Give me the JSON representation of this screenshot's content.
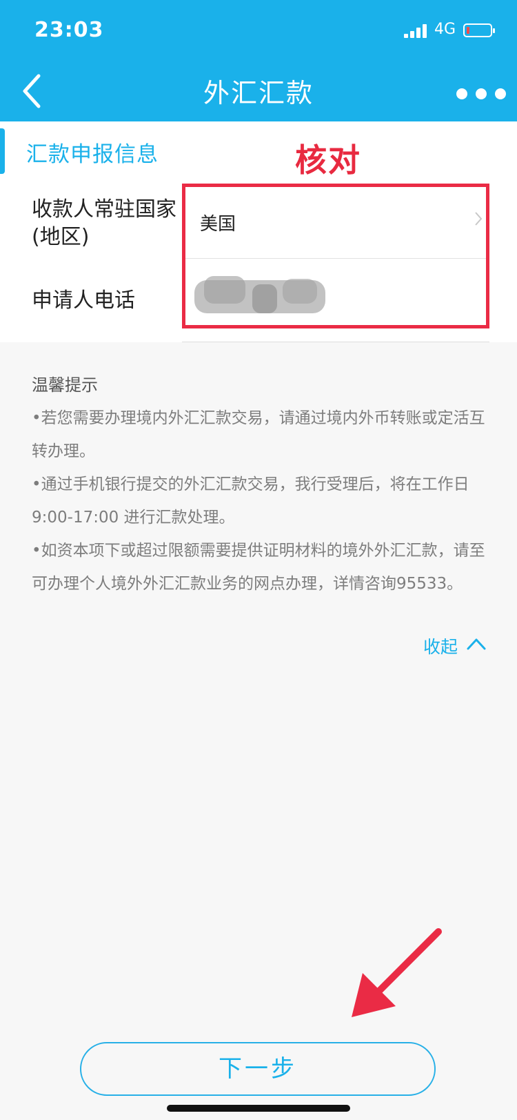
{
  "status_bar": {
    "time": "23:03",
    "network": "4G"
  },
  "nav": {
    "title": "外汇汇款",
    "back_icon": "chevron-left-icon",
    "more_icon": "more-dots-icon"
  },
  "section": {
    "title": "汇款申报信息"
  },
  "annotation": {
    "text": "核对",
    "color": "#e82a40"
  },
  "form": {
    "rows": [
      {
        "label": "收款人常驻国家(地区)",
        "value": "美国"
      },
      {
        "label": "申请人电话",
        "value": ""
      }
    ]
  },
  "tips": {
    "title": "温馨提示",
    "items": [
      "•若您需要办理境内外汇汇款交易，请通过境内外币转账或定活互转办理。",
      "•通过手机银行提交的外汇汇款交易，我行受理后，将在工作日9:00-17:00 进行汇款处理。",
      "•如资本项下或超过限额需要提供证明材料的境外外汇汇款，请至可办理个人境外外汇汇款业务的网点办理，详情咨询95533。"
    ],
    "collapse_label": "收起"
  },
  "actions": {
    "next_label": "下一步"
  },
  "colors": {
    "brand": "#1ab1ea",
    "annotation_red": "#ea2b45",
    "background": "#f7f7f7"
  }
}
